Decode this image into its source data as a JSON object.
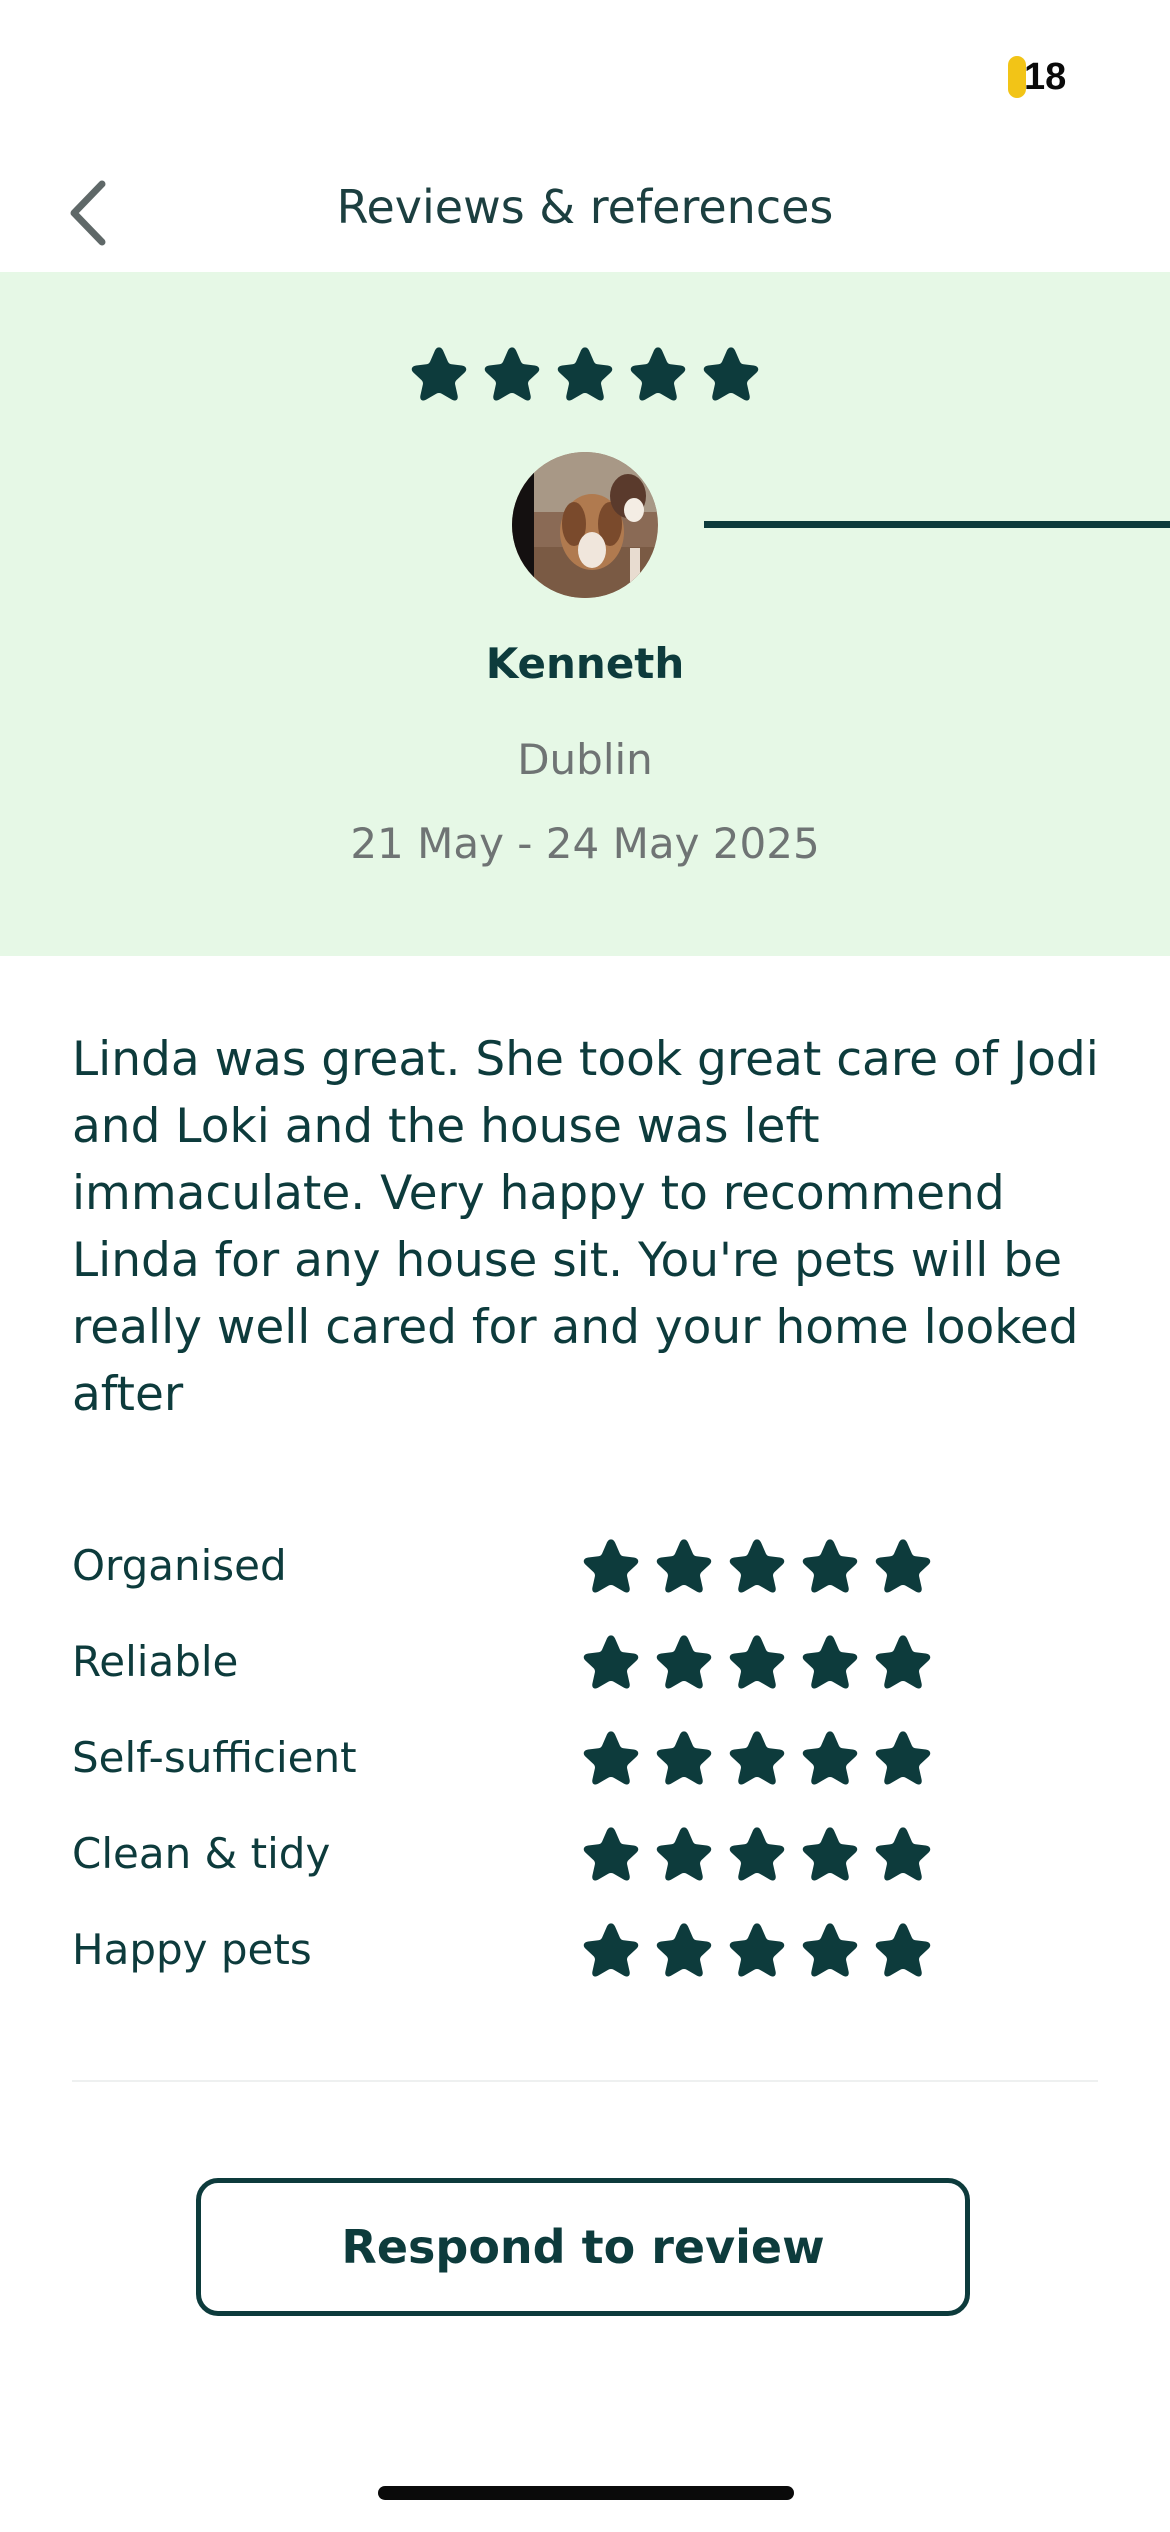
{
  "status_bar": {
    "battery_level": "18",
    "battery_color": "#f2c417"
  },
  "nav": {
    "title": "Reviews & references",
    "back_icon": "chevron-left-icon"
  },
  "review": {
    "overall_rating": 5,
    "reviewer_name": "Kenneth",
    "location": "Dublin",
    "dates": "21 May - 24 May 2025",
    "text": "Linda was great. She took great care of Jodi and Loki and the house was left immaculate.  Very happy to recommend Linda for any house sit. You're pets will be really well cared for and your home looked after"
  },
  "ratings": [
    {
      "label": "Organised",
      "stars": 5
    },
    {
      "label": "Reliable",
      "stars": 5
    },
    {
      "label": "Self-sufficient",
      "stars": 5
    },
    {
      "label": "Clean & tidy",
      "stars": 5
    },
    {
      "label": "Happy pets",
      "stars": 5
    }
  ],
  "actions": {
    "respond_label": "Respond to review"
  },
  "colors": {
    "brand_dark": "#0d3b3c",
    "hero_background": "#e6f8e6",
    "muted_text": "#6f7474"
  }
}
